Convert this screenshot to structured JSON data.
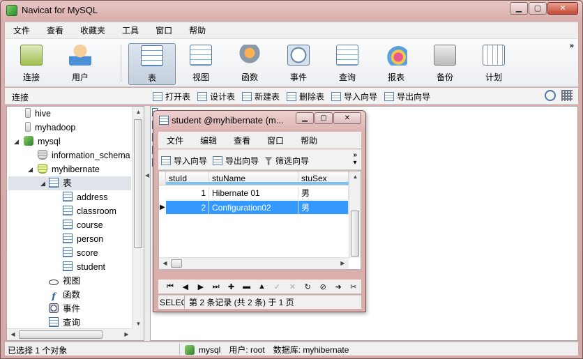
{
  "window": {
    "title": "Navicat for MySQL",
    "minimize": "▁",
    "maximize": "▢",
    "close": "✕"
  },
  "menu": [
    "文件",
    "查看",
    "收藏夹",
    "工具",
    "窗口",
    "帮助"
  ],
  "toolbar": {
    "buttons": [
      {
        "label": "连接",
        "icon": "connection-icon"
      },
      {
        "label": "用户",
        "icon": "user-icon"
      },
      {
        "label": "表",
        "icon": "table-icon"
      },
      {
        "label": "视图",
        "icon": "view-icon"
      },
      {
        "label": "函数",
        "icon": "function-icon"
      },
      {
        "label": "事件",
        "icon": "event-icon"
      },
      {
        "label": "查询",
        "icon": "query-icon"
      },
      {
        "label": "报表",
        "icon": "report-icon"
      },
      {
        "label": "备份",
        "icon": "backup-icon"
      },
      {
        "label": "计划",
        "icon": "schedule-icon"
      }
    ],
    "active": "表",
    "more": "»"
  },
  "subbar": {
    "connection_label": "连接",
    "actions": [
      "打开表",
      "设计表",
      "新建表",
      "删除表",
      "导入向导",
      "导出向导"
    ]
  },
  "tree": {
    "items": [
      {
        "label": "hive",
        "level": 0
      },
      {
        "label": "myhadoop",
        "level": 0
      },
      {
        "label": "mysql",
        "level": 0
      },
      {
        "label": "information_schema",
        "level": 1
      },
      {
        "label": "myhibernate",
        "level": 1
      },
      {
        "label": "表",
        "level": 2
      },
      {
        "label": "address",
        "level": 3
      },
      {
        "label": "classroom",
        "level": 3
      },
      {
        "label": "course",
        "level": 3
      },
      {
        "label": "person",
        "level": 3
      },
      {
        "label": "score",
        "level": 3
      },
      {
        "label": "student",
        "level": 3
      },
      {
        "label": "视图",
        "level": 2
      },
      {
        "label": "函数",
        "level": 2
      },
      {
        "label": "事件",
        "level": 2
      },
      {
        "label": "查询",
        "level": 2
      }
    ]
  },
  "child_window": {
    "title": "student @myhibernate (m...",
    "menu": [
      "文件",
      "编辑",
      "查看",
      "窗口",
      "帮助"
    ],
    "tools": [
      "导入向导",
      "导出向导",
      "筛选向导"
    ],
    "columns": [
      "stuId",
      "stuName",
      "stuSex"
    ],
    "rows": [
      {
        "stuId": "1",
        "stuName": "Hibernate 01",
        "stuSex": "男"
      },
      {
        "stuId": "2",
        "stuName": "Configuration02",
        "stuSex": "男"
      }
    ],
    "selected_row": 2,
    "status_sql": "SELECT",
    "status_text": "第 2 条记录 (共 2 条) 于 1 页"
  },
  "status": {
    "selection": "已选择 1 个对象",
    "connection": "mysql",
    "user": "用户: root",
    "database": "数据库: myhibernate"
  }
}
